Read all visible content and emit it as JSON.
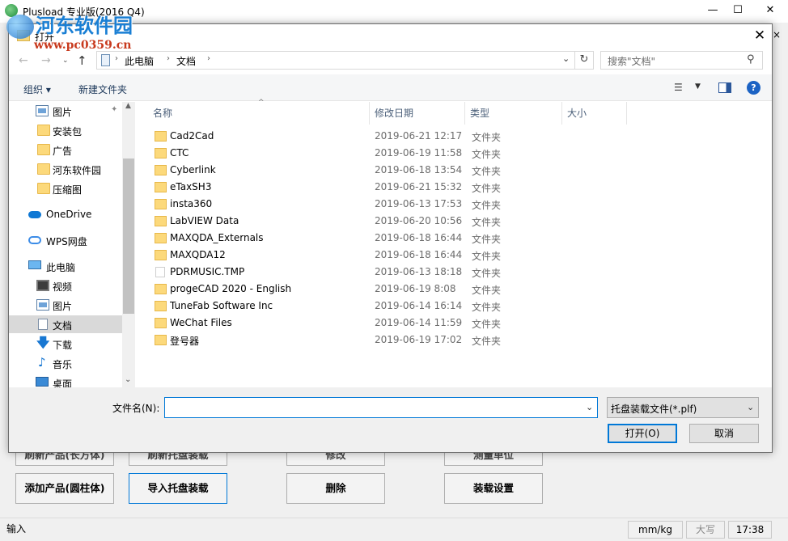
{
  "app": {
    "title": "Plusload 专业版(2016 Q4)",
    "minimize": "—",
    "maximize": "☐",
    "close": "✕",
    "side_close": "×",
    "watermark": {
      "line1": "河东软件园",
      "line2": "www.pc0359.cn"
    },
    "buttons_partial": [
      "刷新产品(长方体)",
      "刷新托盘装载",
      "修改",
      "测量单位"
    ],
    "buttons": [
      "添加产品(圆柱体)",
      "导入托盘装载",
      "删除",
      "装载设置"
    ],
    "status": {
      "input": "输入",
      "unit": "mm/kg",
      "caps": "大写",
      "time": "17:38"
    }
  },
  "dialog": {
    "title": "打开",
    "close": "✕",
    "nav": {
      "back": "←",
      "forward": "→",
      "recent": "⌄",
      "up": "↑",
      "refresh": "↻",
      "dropdown": "⌄"
    },
    "breadcrumb": [
      "此电脑",
      "文档"
    ],
    "breadcrumb_sep": "›",
    "search_placeholder": "搜索\"文档\"",
    "search_icon": "⚲",
    "toolbar": {
      "organize": "组织 ▾",
      "new_folder": "新建文件夹",
      "view_icon": "☰",
      "view_dd": "▼",
      "help": "?"
    },
    "sidebar": [
      {
        "label": "图片",
        "icon": "pictures-icon",
        "pinned": true
      },
      {
        "label": "安装包",
        "icon": "folder-icon"
      },
      {
        "label": "广告",
        "icon": "folder-icon"
      },
      {
        "label": "河东软件园",
        "icon": "folder-icon"
      },
      {
        "label": "压缩图",
        "icon": "folder-icon"
      },
      {
        "label": "OneDrive",
        "icon": "onedrive-icon"
      },
      {
        "label": "WPS网盘",
        "icon": "wps-cloud-icon"
      },
      {
        "label": "此电脑",
        "icon": "computer-icon"
      },
      {
        "label": "视频",
        "icon": "video-icon"
      },
      {
        "label": "图片",
        "icon": "pictures-icon"
      },
      {
        "label": "文档",
        "icon": "document-icon",
        "selected": true
      },
      {
        "label": "下载",
        "icon": "download-icon"
      },
      {
        "label": "音乐",
        "icon": "music-icon"
      },
      {
        "label": "桌面",
        "icon": "desktop-icon"
      }
    ],
    "sidebar_glyphs": {
      "pin": "📌",
      "down": "🡇",
      "music": "♪",
      "scroll_up": "▲",
      "scroll_down": "⌄"
    },
    "columns": {
      "name": "名称",
      "date": "修改日期",
      "type": "类型",
      "size": "大小",
      "sort_caret": "^"
    },
    "files": [
      {
        "name": "Cad2Cad",
        "date": "2019-06-21 12:17",
        "type": "文件夹",
        "kind": "folder"
      },
      {
        "name": "CTC",
        "date": "2019-06-19 11:58",
        "type": "文件夹",
        "kind": "folder"
      },
      {
        "name": "Cyberlink",
        "date": "2019-06-18 13:54",
        "type": "文件夹",
        "kind": "folder"
      },
      {
        "name": "eTaxSH3",
        "date": "2019-06-21 15:32",
        "type": "文件夹",
        "kind": "folder"
      },
      {
        "name": "insta360",
        "date": "2019-06-13 17:53",
        "type": "文件夹",
        "kind": "folder"
      },
      {
        "name": "LabVIEW Data",
        "date": "2019-06-20 10:56",
        "type": "文件夹",
        "kind": "folder"
      },
      {
        "name": "MAXQDA_Externals",
        "date": "2019-06-18 16:44",
        "type": "文件夹",
        "kind": "folder"
      },
      {
        "name": "MAXQDA12",
        "date": "2019-06-18 16:44",
        "type": "文件夹",
        "kind": "folder"
      },
      {
        "name": "PDRMUSIC.TMP",
        "date": "2019-06-13 18:18",
        "type": "文件夹",
        "kind": "file"
      },
      {
        "name": "progeCAD 2020 - English",
        "date": "2019-06-19 8:08",
        "type": "文件夹",
        "kind": "folder"
      },
      {
        "name": "TuneFab Software Inc",
        "date": "2019-06-14 16:14",
        "type": "文件夹",
        "kind": "folder"
      },
      {
        "name": "WeChat Files",
        "date": "2019-06-14 11:59",
        "type": "文件夹",
        "kind": "folder"
      },
      {
        "name": "登号器",
        "date": "2019-06-19 17:02",
        "type": "文件夹",
        "kind": "folder"
      }
    ],
    "filename_label": "文件名(N):",
    "filename_value": "",
    "filename_dd": "⌄",
    "filter": "托盘装载文件(*.plf)",
    "filter_dd": "⌄",
    "open_button": "打开(O)",
    "cancel_button": "取消"
  }
}
